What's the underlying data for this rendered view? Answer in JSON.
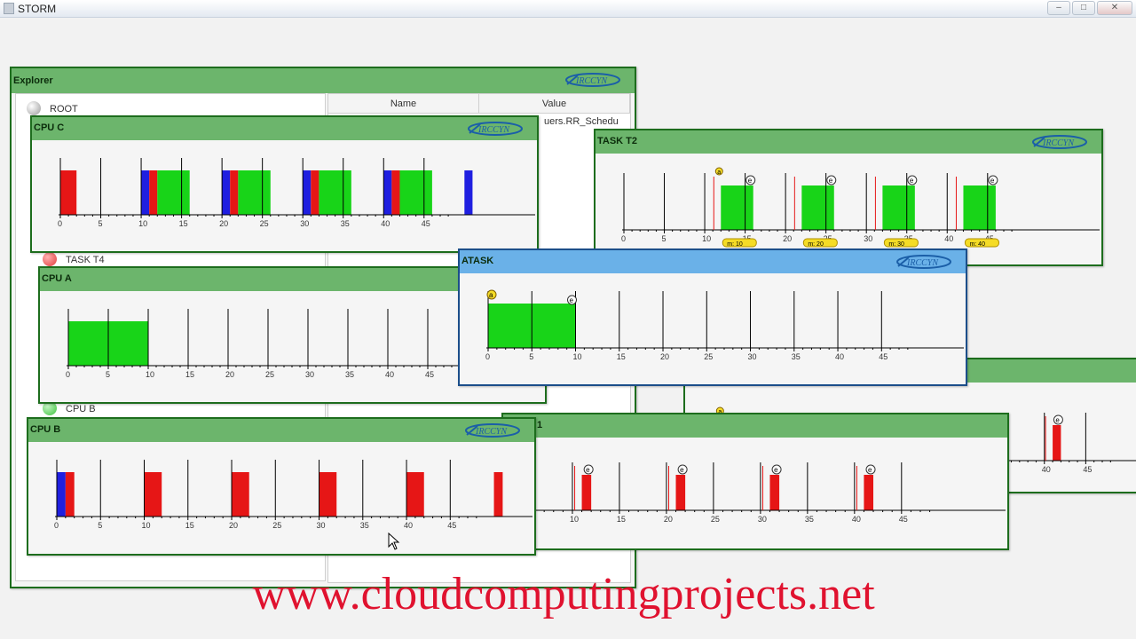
{
  "window": {
    "title": "STORM",
    "buttons": [
      "–",
      "□",
      "✕"
    ]
  },
  "explorer": {
    "title": "Explorer",
    "tree": [
      {
        "label": "ROOT",
        "color": "#9a9a9a"
      },
      {
        "label": "TASK T4",
        "color": "#e33b3b"
      },
      {
        "label": "CPU B",
        "color": "#3cc43c"
      }
    ],
    "columns": {
      "name": "Name",
      "value": "Value"
    },
    "rows": [
      {
        "name": "",
        "value": "uers.RR_Schedu"
      }
    ]
  },
  "ticks": [
    "0",
    "5",
    "10",
    "15",
    "20",
    "25",
    "30",
    "35",
    "40",
    "45"
  ],
  "colors": {
    "green": "#18d418",
    "red": "#e61616",
    "blue": "#1f1fe0",
    "yellow": "#f5dc26",
    "title_green": "#6cb56c",
    "title_blue": "#6ab1e8"
  },
  "windows": {
    "cpu_c": {
      "title": "CPU C"
    },
    "task_t2": {
      "title": "TASK T2"
    },
    "cpu_a": {
      "title": "CPU A"
    },
    "atask": {
      "title": "ATASK"
    },
    "cpu_b": {
      "title": "CPU B"
    },
    "task_t1": {
      "title": "1"
    },
    "task_t3": {
      "title": ""
    }
  },
  "chart_data": [
    {
      "id": "cpu_c",
      "type": "bar",
      "xlim": [
        0,
        48
      ],
      "bars": [
        {
          "from": 0,
          "to": 2,
          "color": "red"
        },
        {
          "from": 10,
          "to": 11,
          "color": "blue"
        },
        {
          "from": 11,
          "to": 12,
          "color": "red"
        },
        {
          "from": 12,
          "to": 16,
          "color": "green"
        },
        {
          "from": 20,
          "to": 21,
          "color": "blue"
        },
        {
          "from": 21,
          "to": 22,
          "color": "red"
        },
        {
          "from": 22,
          "to": 26,
          "color": "green"
        },
        {
          "from": 30,
          "to": 31,
          "color": "blue"
        },
        {
          "from": 31,
          "to": 32,
          "color": "red"
        },
        {
          "from": 32,
          "to": 36,
          "color": "green"
        },
        {
          "from": 40,
          "to": 41,
          "color": "blue"
        },
        {
          "from": 41,
          "to": 42,
          "color": "red"
        },
        {
          "from": 42,
          "to": 46,
          "color": "green"
        },
        {
          "from": 50,
          "to": 51,
          "color": "blue"
        }
      ]
    },
    {
      "id": "task_t2",
      "type": "bar",
      "xlim": [
        0,
        47
      ],
      "bars": [
        {
          "from": 12,
          "to": 16,
          "color": "green"
        },
        {
          "from": 22,
          "to": 26,
          "color": "green"
        },
        {
          "from": 32,
          "to": 36,
          "color": "green"
        },
        {
          "from": 42,
          "to": 46,
          "color": "green"
        }
      ],
      "event_labels": [
        "e",
        "e",
        "e",
        "e"
      ],
      "badges": [
        "m: 10",
        "m: 20",
        "m: 30",
        "m: 40"
      ],
      "top_marker": "a"
    },
    {
      "id": "cpu_a",
      "type": "bar",
      "xlim": [
        0,
        45
      ],
      "bars": [
        {
          "from": 0,
          "to": 10,
          "color": "green"
        }
      ]
    },
    {
      "id": "atask",
      "type": "bar",
      "xlim": [
        0,
        49
      ],
      "bars": [
        {
          "from": 0,
          "to": 10,
          "color": "green"
        }
      ],
      "start_label": "a",
      "end_label": "e"
    },
    {
      "id": "cpu_b",
      "type": "bar",
      "xlim": [
        0,
        49
      ],
      "bars": [
        {
          "from": 0,
          "to": 1,
          "color": "blue"
        },
        {
          "from": 1,
          "to": 2,
          "color": "red"
        },
        {
          "from": 10,
          "to": 12,
          "color": "red"
        },
        {
          "from": 20,
          "to": 22,
          "color": "red"
        },
        {
          "from": 30,
          "to": 32,
          "color": "red"
        },
        {
          "from": 40,
          "to": 42,
          "color": "red"
        },
        {
          "from": 50,
          "to": 51,
          "color": "red"
        }
      ]
    },
    {
      "id": "task_t3",
      "type": "bar",
      "xlim": [
        0,
        49
      ],
      "bars": [
        {
          "from": 1,
          "to": 2,
          "color": "red"
        },
        {
          "from": 11,
          "to": 12,
          "color": "red"
        },
        {
          "from": 21,
          "to": 22,
          "color": "red"
        },
        {
          "from": 31,
          "to": 32,
          "color": "red"
        },
        {
          "from": 41,
          "to": 42,
          "color": "red"
        }
      ],
      "event_labels": [
        "e",
        "e",
        "e",
        "e",
        "e"
      ],
      "top_marker": "a"
    }
  ],
  "watermark": "www.cloudcomputingprojects.net"
}
